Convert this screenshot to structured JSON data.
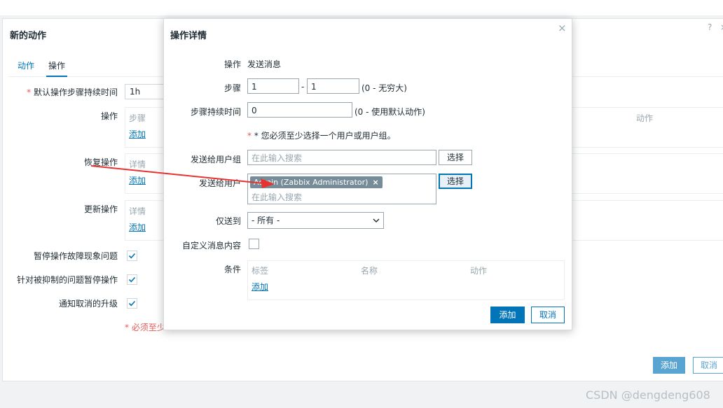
{
  "background": {
    "title": "新的动作",
    "help_symbol": "?",
    "close_symbol": "×",
    "tabs": [
      "动作",
      "操作"
    ],
    "default_duration_label": "默认操作步骤持续时间",
    "default_duration_value": "1h",
    "operations_label": "操作",
    "operations_col_steps": "步骤",
    "operations_col_action": "动作",
    "recovery_label": "恢复操作",
    "recovery_col_details": "详情",
    "update_label": "更新操作",
    "update_col_details": "详情",
    "add_link": "添加",
    "pause_label": "暂停操作故障现象问题",
    "suppressed_label": "针对被抑制的问题暂停操作",
    "notify_cancel_label": "通知取消的升级",
    "required_note": "* 必须至少",
    "add_button": "添加",
    "cancel_button": "取消"
  },
  "modal": {
    "title": "操作详情",
    "close_symbol": "×",
    "operation_label": "操作",
    "operation_value": "发送消息",
    "steps_label": "步骤",
    "step_from": "1",
    "step_separator": "-",
    "step_to": "1",
    "steps_hint": "(0 - 无穷大)",
    "step_duration_label": "步骤持续时间",
    "step_duration_value": "0",
    "step_duration_hint": "(0 - 使用默认动作)",
    "required_note": "* 您必须至少选择一个用户或用户组。",
    "send_group_label": "发送给用户组",
    "search_placeholder": "在此输入搜索",
    "select_button": "选择",
    "send_user_label": "发送给用户",
    "user_tag": "Admin (Zabbix Administrator)",
    "tag_remove": "×",
    "send_only_label": "仅送到",
    "send_only_value": "- 所有 -",
    "custom_message_label": "自定义消息内容",
    "conditions_label": "条件",
    "cond_col_label": "标签",
    "cond_col_name": "名称",
    "cond_col_action": "动作",
    "cond_add_link": "添加",
    "add_button": "添加",
    "cancel_button": "取消"
  },
  "watermark": "CSDN @dengdeng608",
  "colors": {
    "accent": "#0275b8",
    "required": "#e45959",
    "annotation_arrow": "#e8322f",
    "tag_bg": "#768d99"
  },
  "icons": [
    "close-icon",
    "help-icon",
    "checkmark-icon",
    "chevron-down-icon",
    "remove-tag-icon",
    "annotation-arrow"
  ]
}
